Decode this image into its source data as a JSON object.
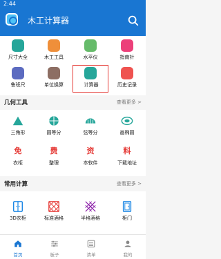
{
  "status_bar": {
    "time": "2:44"
  },
  "app_bar": {
    "title": "木工计算器"
  },
  "top_tools": [
    {
      "label": "尺寸大全",
      "icon": "ruler-icon",
      "color": "#26a69a"
    },
    {
      "label": "木工工具",
      "icon": "toolbox-icon",
      "color": "#ef8f3a"
    },
    {
      "label": "水平仪",
      "icon": "level-icon",
      "color": "#66bb6a"
    },
    {
      "label": "指南针",
      "icon": "compass-icon",
      "color": "#ec407a"
    },
    {
      "label": "鲁班尺",
      "icon": "luban-ruler-icon",
      "color": "#5c6bc0"
    },
    {
      "label": "单位换算",
      "icon": "unit-convert-icon",
      "color": "#8d6e63"
    },
    {
      "label": "计算器",
      "icon": "calculator-icon",
      "color": "#26a69a"
    },
    {
      "label": "历史记录",
      "icon": "history-icon",
      "color": "#ef5350"
    }
  ],
  "geometry_section": {
    "title": "几何工具",
    "see_more": "查看更多 >",
    "items": [
      {
        "label": "三角形",
        "icon": "triangle-icon",
        "color": "#26a69a"
      },
      {
        "label": "圆等分",
        "icon": "circle-divide-icon",
        "color": "#26a69a"
      },
      {
        "label": "弦等分",
        "icon": "chord-divide-icon",
        "color": "#26a69a"
      },
      {
        "label": "画椭圆",
        "icon": "ellipse-icon",
        "color": "#26a69a"
      }
    ]
  },
  "promo_items": [
    {
      "label": "衣柜",
      "glyph": "免",
      "color": "#e53935"
    },
    {
      "label": "整理",
      "glyph": "费",
      "color": "#e53935"
    },
    {
      "label": "本软件",
      "glyph": "资",
      "color": "#e53935"
    },
    {
      "label": "下载地址",
      "glyph": "料",
      "color": "#e53935"
    }
  ],
  "common_section": {
    "title": "常用计算",
    "see_more": "查看更多 >",
    "items": [
      {
        "label": "3D衣柜",
        "icon": "wardrobe-3d-icon",
        "color": "#1e88e5"
      },
      {
        "label": "标准酒格",
        "icon": "wine-rack-icon",
        "color": "#e53935"
      },
      {
        "label": "半格酒格",
        "icon": "half-wine-rack-icon",
        "color": "#8e24aa"
      },
      {
        "label": "柜门",
        "icon": "cabinet-door-icon",
        "color": "#1e88e5"
      }
    ]
  },
  "bottom_nav": [
    {
      "label": "首页",
      "icon": "home-icon",
      "active": true
    },
    {
      "label": "板子",
      "icon": "board-icon",
      "active": false
    },
    {
      "label": "清单",
      "icon": "list-icon",
      "active": false
    },
    {
      "label": "我的",
      "icon": "profile-icon",
      "active": false
    }
  ],
  "colors": {
    "primary": "#1976d2",
    "selected_border": "#e53935"
  }
}
